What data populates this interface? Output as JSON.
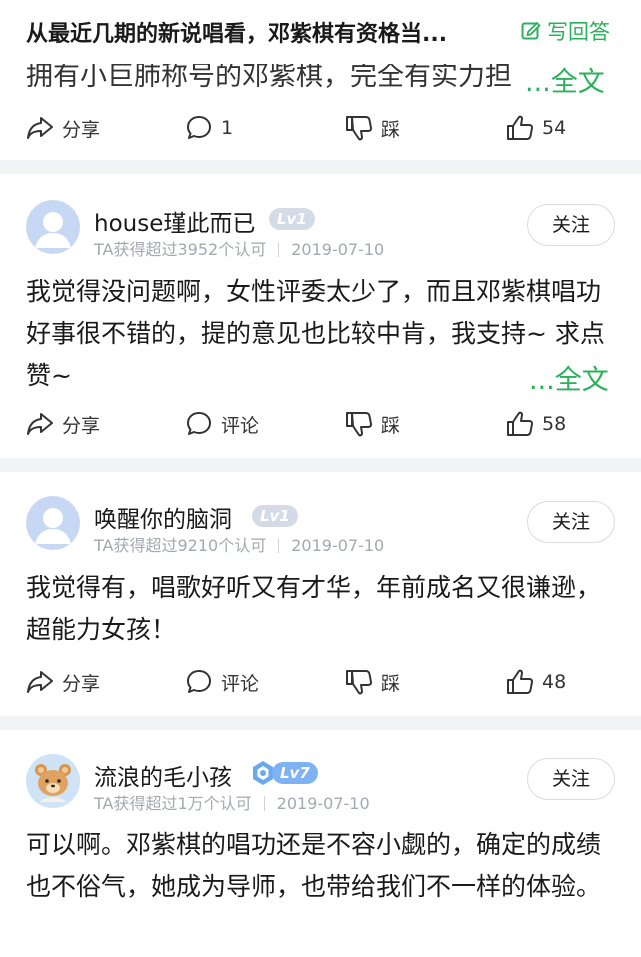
{
  "header": {
    "title": "从最近几期的新说唱看，邓紫棋有资格当...",
    "write_answer": "写回答"
  },
  "top_card": {
    "snippet": "拥有小巨肺称号的邓紫棋，完全有实力担",
    "more": "...全文",
    "actions": {
      "share": "分享",
      "comment": "1",
      "dislike": "踩",
      "like": "54"
    }
  },
  "answers": [
    {
      "username": "house瑾此而已",
      "level": "Lv1",
      "approvals": "TA获得超过3952个认可",
      "date": "2019-07-10",
      "follow": "关注",
      "text": "我觉得没问题啊，女性评委太少了，而且邓紫棋唱功好事很不错的，提的意见也比较中肯，我支持~ 求点赞~",
      "more": "...全文",
      "actions": {
        "share": "分享",
        "comment": "评论",
        "dislike": "踩",
        "like": "58"
      }
    },
    {
      "username": "唤醒你的脑洞",
      "level": "Lv1",
      "approvals": "TA获得超过9210个认可",
      "date": "2019-07-10",
      "follow": "关注",
      "text": "我觉得有，唱歌好听又有才华，年前成名又很谦逊，超能力女孩！",
      "actions": {
        "share": "分享",
        "comment": "评论",
        "dislike": "踩",
        "like": "48"
      }
    },
    {
      "username": "流浪的毛小孩",
      "level": "Lv7",
      "approvals": "TA获得超过1万个认可",
      "date": "2019-07-10",
      "follow": "关注",
      "text": "可以啊。邓紫棋的唱功还是不容小觑的，确定的成绩也不俗气，她成为导师，也带给我们不一样的体验。"
    }
  ],
  "colors": {
    "accent": "#2bb15b",
    "meta": "#a4a8b0",
    "divider": "#f2f3f5"
  },
  "icons": [
    "edit-icon",
    "share-icon",
    "comment-icon",
    "dislike-icon",
    "like-icon",
    "default-avatar-icon",
    "bear-avatar",
    "vip-badge-icon"
  ]
}
